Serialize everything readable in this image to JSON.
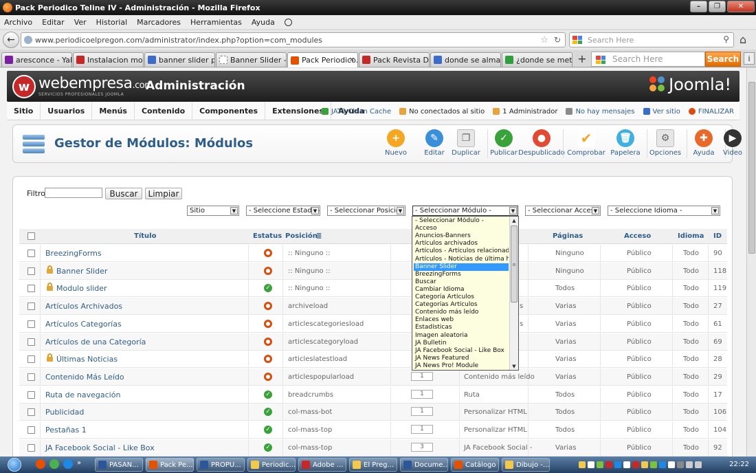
{
  "window": {
    "title": "Pack Periodico Teline IV - Administración - Mozilla Firefox",
    "controls": [
      "–",
      "❐",
      "✕"
    ]
  },
  "menubar": [
    "Archivo",
    "Editar",
    "Ver",
    "Historial",
    "Marcadores",
    "Herramientas",
    "Ayuda"
  ],
  "navbar": {
    "url": "www.periodicoelpregon.com/administrator/index.php?option=com_modules",
    "search_placeholder": "Search Here"
  },
  "tabs": [
    {
      "label": "aresconce - Yaho...",
      "color": "#7b1fa2"
    },
    {
      "label": "Instalacion modul...",
      "color": "#c62828"
    },
    {
      "label": "banner slider par...",
      "color": "#3b6cc9"
    },
    {
      "label": "Banner Slider - Fo...",
      "color": "#ffffff"
    },
    {
      "label": "Pack Periodico...",
      "color": "#e65100",
      "active": true
    },
    {
      "label": "Pack Revista Digit...",
      "color": "#c62828"
    },
    {
      "label": "donde se almace...",
      "color": "#3b6cc9"
    },
    {
      "label": "¿donde se meten ...",
      "color": "#2e9e3e"
    }
  ],
  "searchbar": {
    "placeholder": "Search Here",
    "button": "Search"
  },
  "joomla": {
    "brand": "webempresa",
    "brand_suffix": ".com",
    "tagline": "SERVICIOS PROFESIONALES JOOMLA",
    "admin_title": "Administración",
    "joomla_logo": "Joomla!",
    "menu": [
      "Sitio",
      "Usuarios",
      "Menús",
      "Contenido",
      "Componentes",
      "Extensiones",
      "Ayuda"
    ],
    "status": [
      {
        "label": "JAT3 Clean Cache",
        "color": "#3aa23a"
      },
      {
        "label": "No conectados al sitio",
        "color": "#e8a33a"
      },
      {
        "label": "1 Administrador",
        "color": "#e8a33a"
      },
      {
        "label": "No hay mensajes",
        "color": "#8a8a8a"
      },
      {
        "label": "Ver sitio",
        "color": "#3b6cc9"
      },
      {
        "label": "FINALIZAR",
        "color": "#d94d0e"
      }
    ],
    "page_title": "Gestor de Módulos: Módulos",
    "toolbar": [
      {
        "label": "Nuevo",
        "icon": "plus-icon",
        "color": "#f5a623",
        "glyph": "+"
      },
      {
        "label": "Editar",
        "icon": "pencil-icon",
        "color": "#3b8fd9",
        "glyph": "✎"
      },
      {
        "label": "Duplicar",
        "icon": "copy-icon",
        "color": "#e6e6e6",
        "glyph": "❐"
      },
      {
        "label": "Publicar",
        "icon": "check-icon",
        "color": "#3aa23a",
        "glyph": "✓"
      },
      {
        "label": "Despublicado",
        "icon": "unpublish-icon",
        "color": "#e24a33",
        "glyph": "●"
      },
      {
        "label": "Comprobar",
        "icon": "checkmark-icon",
        "color": "#ffffff",
        "glyph": "✔"
      },
      {
        "label": "Papelera",
        "icon": "trash-icon",
        "color": "#3fb0e0",
        "glyph": "🗑"
      },
      {
        "label": "Opciones",
        "icon": "options-icon",
        "color": "#e6e6e6",
        "glyph": "⚙"
      },
      {
        "label": "Ayuda",
        "icon": "help-icon",
        "color": "#e8692a",
        "glyph": "✚"
      },
      {
        "label": "Video",
        "icon": "video-icon",
        "color": "#333333",
        "glyph": "▶"
      }
    ]
  },
  "filters": {
    "label": "Filtro:",
    "search_value": "",
    "buscar": "Buscar",
    "limpiar": "Limpiar",
    "selects": [
      "Sitio",
      "- Seleccione Estado -",
      "- Seleccionar Posición -",
      "- Seleccionar Módulo -",
      "- Seleccionar Acceso -",
      "- Seleccione Idioma -"
    ]
  },
  "dropdown": {
    "items": [
      "- Seleccionar Módulo -",
      "Acceso",
      "Anuncios-Banners",
      "Artículos archivados",
      "Artículos - Artículos relacionados",
      "Artículos - Noticias de última hora",
      "Banner Slider",
      "BreezingForms",
      "Buscar",
      "Cambiar Idioma",
      "Categoría Artículos",
      "Categorías Artículos",
      "Contenido más leído",
      "Enlaces web",
      "Estadísticas",
      "Imagen aleatoria",
      "JA Bulletin",
      "JA Facebook Social - Like Box",
      "JA News Featured",
      "JA News Pro! Module"
    ],
    "selected_index": 6
  },
  "table": {
    "headers": {
      "title": "Título",
      "status": "Estatus",
      "position": "Posición",
      "pages": "Páginas",
      "access": "Acceso",
      "language": "Idioma",
      "id": "ID"
    },
    "rows": [
      {
        "title": "BreezingForms",
        "lock": false,
        "status": "off",
        "position": ":: Ninguno ::",
        "order": "",
        "type": "",
        "pages": "Ninguno",
        "access": "Público",
        "lang": "Todo",
        "id": "90"
      },
      {
        "title": "Banner Slider",
        "lock": true,
        "status": "off",
        "position": ":: Ninguno ::",
        "order": "",
        "type": "",
        "pages": "Ninguno",
        "access": "Público",
        "lang": "Todo",
        "id": "118"
      },
      {
        "title": "Modulo slider",
        "lock": true,
        "status": "on",
        "position": ":: Ninguno ::",
        "order": "",
        "type": "",
        "pages": "Todos",
        "access": "Público",
        "lang": "Todo",
        "id": "119"
      },
      {
        "title": "Artículos Archivados",
        "lock": false,
        "status": "off",
        "position": "archiveload",
        "order": "",
        "type": "s",
        "pages": "Varias",
        "access": "Público",
        "lang": "Todo",
        "id": "27"
      },
      {
        "title": "Artículos Categorías",
        "lock": false,
        "status": "off",
        "position": "articlescategoriesload",
        "order": "",
        "type": "s",
        "pages": "Varias",
        "access": "Público",
        "lang": "Todo",
        "id": "61"
      },
      {
        "title": "Artículos de una Categoría",
        "lock": false,
        "status": "off",
        "position": "articlescategoryload",
        "order": "",
        "type": "",
        "pages": "Varias",
        "access": "Público",
        "lang": "Todo",
        "id": "69"
      },
      {
        "title": "Últimas Noticias",
        "lock": true,
        "status": "off",
        "position": "articleslatestload",
        "order": "",
        "type": "",
        "pages": "Varias",
        "access": "Público",
        "lang": "Todo",
        "id": "28"
      },
      {
        "title": "Contenido Más Leído",
        "lock": false,
        "status": "off",
        "position": "articlespopularload",
        "order": "1",
        "type": "Contenido más leído",
        "pages": "Varias",
        "access": "Público",
        "lang": "Todo",
        "id": "29"
      },
      {
        "title": "Ruta de navegación",
        "lock": false,
        "status": "on",
        "position": "breadcrumbs",
        "order": "1",
        "type": "Ruta",
        "pages": "Todos",
        "access": "Público",
        "lang": "Todo",
        "id": "17"
      },
      {
        "title": "Publicidad",
        "lock": false,
        "status": "on",
        "position": "col-mass-bot",
        "order": "1",
        "type": "Personalizar HTML",
        "pages": "Todos",
        "access": "Público",
        "lang": "Todo",
        "id": "106"
      },
      {
        "title": "Pestañas 1",
        "lock": false,
        "status": "on",
        "position": "col-mass-top",
        "order": "1",
        "type": "Personalizar HTML",
        "pages": "Todos",
        "access": "Público",
        "lang": "Todo",
        "id": "104"
      },
      {
        "title": "JA Facebook Social - Like Box",
        "lock": false,
        "status": "on",
        "position": "col-mass-top",
        "order": "3",
        "type": "JA Facebook Social -",
        "pages": "Varias",
        "access": "Público",
        "lang": "Todo",
        "id": "92"
      }
    ]
  },
  "taskbar": {
    "items": [
      {
        "label": "PASAN...",
        "color": "#2b579a"
      },
      {
        "label": "Pack Pe...",
        "color": "#e65100",
        "active": true
      },
      {
        "label": "PROPU...",
        "color": "#2b579a"
      },
      {
        "label": "Periodic...",
        "color": "#f2c94c"
      },
      {
        "label": "Adobe ...",
        "color": "#c62828"
      },
      {
        "label": "El Preg...",
        "color": "#f2c94c"
      },
      {
        "label": "Docume...",
        "color": "#2b579a"
      },
      {
        "label": "Catálogo",
        "color": "#e65100"
      },
      {
        "label": "Dibujo -...",
        "color": "#f2c94c"
      }
    ],
    "time": "22:22"
  }
}
